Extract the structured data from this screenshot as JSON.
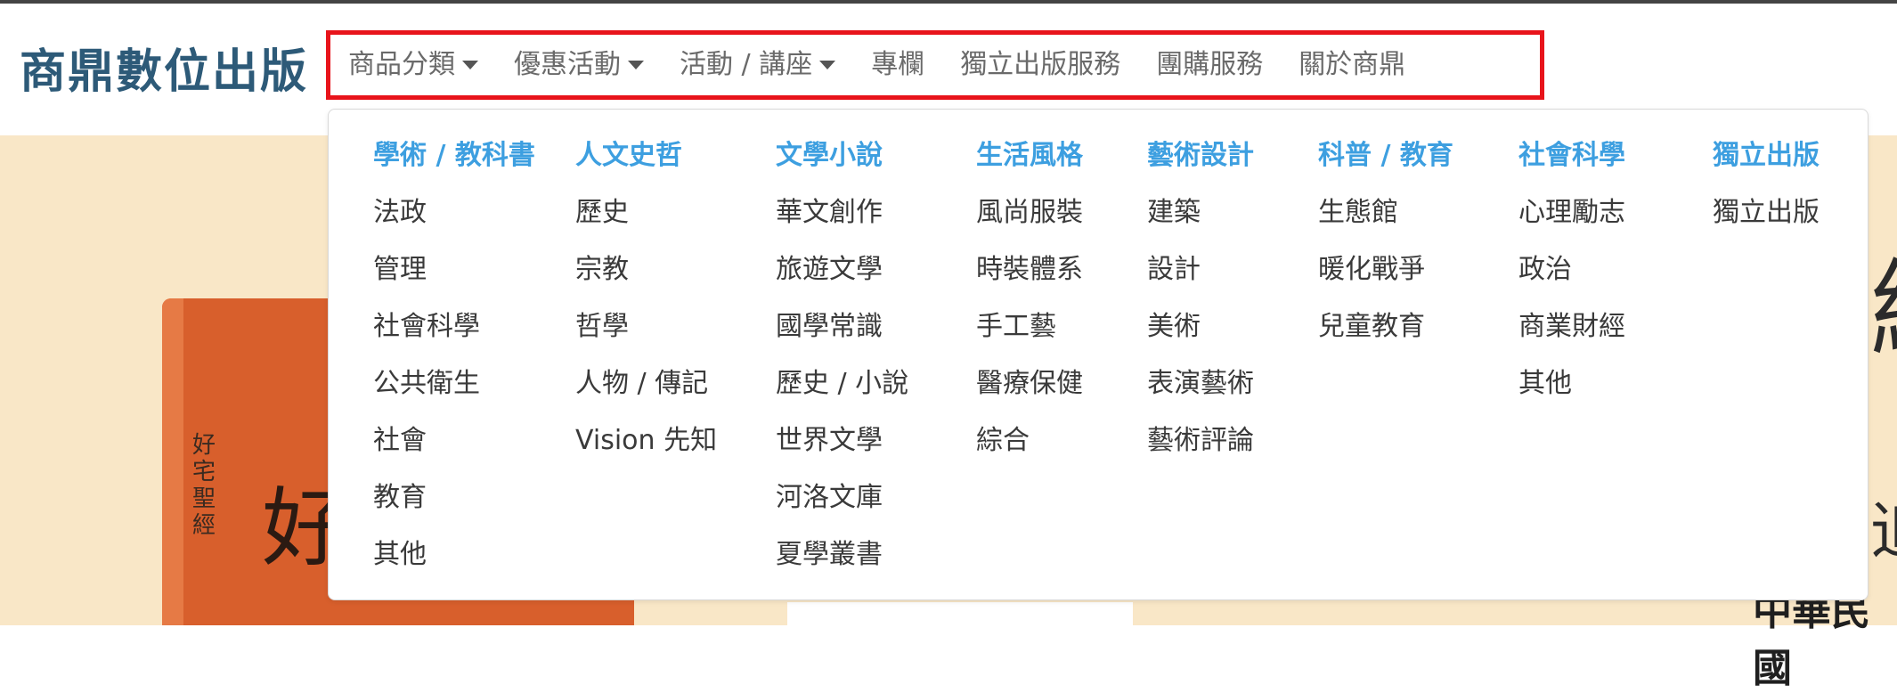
{
  "logo": "商鼎數位出版",
  "nav": [
    {
      "label": "商品分類",
      "has_dropdown": true
    },
    {
      "label": "優惠活動",
      "has_dropdown": true
    },
    {
      "label": "活動 / 講座",
      "has_dropdown": true
    },
    {
      "label": "專欄",
      "has_dropdown": false
    },
    {
      "label": "獨立出版服務",
      "has_dropdown": false
    },
    {
      "label": "團購服務",
      "has_dropdown": false
    },
    {
      "label": "關於商鼎",
      "has_dropdown": false
    }
  ],
  "dropdown": {
    "columns": [
      {
        "heading": "學術 / 教科書",
        "items": [
          "法政",
          "管理",
          "社會科學",
          "公共衛生",
          "社會",
          "教育",
          "其他"
        ]
      },
      {
        "heading": "人文史哲",
        "items": [
          "歷史",
          "宗教",
          "哲學",
          "人物 / 傳記",
          "Vision 先知"
        ]
      },
      {
        "heading": "文學小說",
        "items": [
          "華文創作",
          "旅遊文學",
          "國學常識",
          "歷史 / 小說",
          "世界文學",
          "河洛文庫",
          "夏學叢書"
        ]
      },
      {
        "heading": "生活風格",
        "items": [
          "風尚服裝",
          "時裝體系",
          "手工藝",
          "醫療保健",
          "綜合"
        ]
      },
      {
        "heading": "藝術設計",
        "items": [
          "建築",
          "設計",
          "美術",
          "表演藝術",
          "藝術評論"
        ]
      },
      {
        "heading": "科普 / 教育",
        "items": [
          "生態館",
          "暖化戰爭",
          "兒童教育"
        ]
      },
      {
        "heading": "社會科學",
        "items": [
          "心理勵志",
          "政治",
          "商業財經",
          "其他"
        ]
      },
      {
        "heading": "獨立出版",
        "items": [
          "獨立出版"
        ]
      }
    ]
  },
  "hero": {
    "book_vertical_title": "好宅聖經",
    "book_big_char": "好",
    "right_glyph": "緣",
    "right_glyph2": "追",
    "right_text": "中華民國"
  },
  "colors": {
    "logo": "#2d5a78",
    "nav_text": "#6a6a6a",
    "highlight_border": "#e8141b",
    "heading_blue": "#3d9fe0",
    "hero_bg": "#f9e7c7",
    "book": "#d85f2c"
  }
}
